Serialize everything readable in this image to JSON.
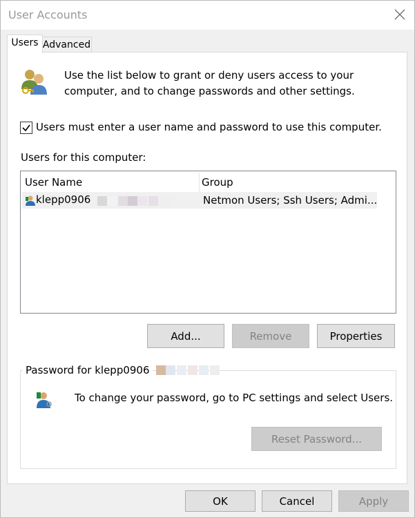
{
  "window": {
    "title": "User Accounts"
  },
  "tabs": [
    {
      "label": "Users"
    },
    {
      "label": "Advanced"
    }
  ],
  "intro": {
    "text": "Use the list below to grant or deny users access to your computer, and to change passwords and other settings."
  },
  "require_login": {
    "checked": true,
    "label": "Users must enter a user name and password to use this computer."
  },
  "users": {
    "label": "Users for this computer:",
    "columns": [
      "User Name",
      "Group"
    ],
    "rows": [
      {
        "user_name": "klepp0906",
        "group": "Netmon Users; Ssh Users; Admi..."
      }
    ]
  },
  "buttons": {
    "add": "Add...",
    "remove": "Remove",
    "properties": "Properties"
  },
  "password_group": {
    "legend": "Password for klepp0906",
    "text": "To change your password, go to PC settings and select Users.",
    "reset": "Reset Password..."
  },
  "footer": {
    "ok": "OK",
    "cancel": "Cancel",
    "apply": "Apply"
  },
  "icons": {
    "close": "close-icon",
    "users_group": "users-group-icon",
    "user_row": "user-icon",
    "user_key": "user-key-icon",
    "checkmark": "checkmark-icon"
  }
}
